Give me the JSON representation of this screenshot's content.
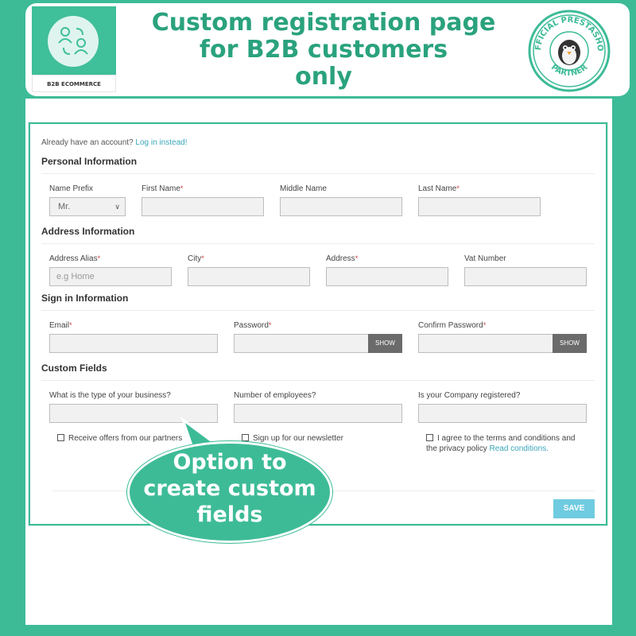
{
  "header": {
    "headline_line1": "Custom registration page",
    "headline_line2": "for B2B customers",
    "headline_line3": "only",
    "logo_caption": "B2B ECOMMERCE",
    "badge_top": "OFFICIAL PRESTASHOP",
    "badge_bottom": "PARTNER"
  },
  "form": {
    "already_text": "Already have an account?",
    "login_link": "Log in instead!",
    "sections": {
      "personal": "Personal Information",
      "address": "Address Information",
      "signin": "Sign in Information",
      "custom": "Custom Fields"
    },
    "personal": {
      "prefix_label": "Name Prefix",
      "prefix_value": "Mr.",
      "first_label": "First Name",
      "middle_label": "Middle Name",
      "last_label": "Last Name"
    },
    "address": {
      "alias_label": "Address Alias",
      "alias_placeholder": "e.g Home",
      "city_label": "City",
      "address_label": "Address",
      "vat_label": "Vat Number"
    },
    "signin": {
      "email_label": "Email",
      "password_label": "Password",
      "confirm_label": "Confirm Password",
      "show_label": "SHOW"
    },
    "custom": {
      "business_label": "What is the type of your business?",
      "employees_label": "Number of employees?",
      "registered_label": "Is your Company registered?",
      "offers_label": "Receive offers from our partners",
      "newsletter_label": "Sign up for our newsletter",
      "terms_label": "I agree to the terms and conditions and",
      "terms_label2": "the privacy policy",
      "terms_link": "Read conditions."
    },
    "required_mark": "*",
    "save_label": "SAVE"
  },
  "bubble": {
    "line1": "Option to",
    "line2": "create custom",
    "line3": "fields"
  },
  "colors": {
    "brand_green": "#3dbb97",
    "link_blue": "#3aa6b9",
    "save_blue": "#6fcbe0"
  }
}
